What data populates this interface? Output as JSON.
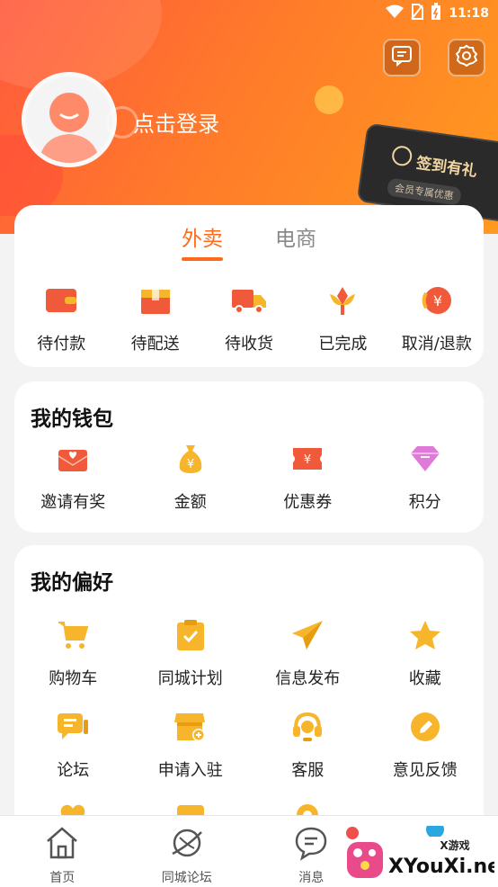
{
  "status_bar": {
    "time": "11:18"
  },
  "profile": {
    "login_label": "点击登录"
  },
  "signin_card": {
    "title": "签到有礼",
    "subtitle": "会员专属优惠"
  },
  "order_tabs": [
    {
      "label": "外卖",
      "active": true
    },
    {
      "label": "电商",
      "active": false
    }
  ],
  "orders": [
    {
      "label": "待付款",
      "icon": "wallet-icon"
    },
    {
      "label": "待配送",
      "icon": "package-icon"
    },
    {
      "label": "待收货",
      "icon": "truck-icon"
    },
    {
      "label": "已完成",
      "icon": "flower-icon"
    },
    {
      "label": "取消/退款",
      "icon": "refund-icon"
    }
  ],
  "wallet": {
    "title": "我的钱包",
    "items": [
      {
        "label": "邀请有奖",
        "icon": "envelope-heart-icon"
      },
      {
        "label": "金额",
        "icon": "money-bag-icon"
      },
      {
        "label": "优惠券",
        "icon": "coupon-icon"
      },
      {
        "label": "积分",
        "icon": "diamond-icon"
      }
    ]
  },
  "preferences": {
    "title": "我的偏好",
    "row1": [
      {
        "label": "购物车",
        "icon": "cart-icon"
      },
      {
        "label": "同城计划",
        "icon": "clipboard-check-icon"
      },
      {
        "label": "信息发布",
        "icon": "paper-plane-icon"
      },
      {
        "label": "收藏",
        "icon": "star-icon"
      }
    ],
    "row2": [
      {
        "label": "论坛",
        "icon": "chat-bubbles-icon"
      },
      {
        "label": "申请入驻",
        "icon": "store-add-icon"
      },
      {
        "label": "客服",
        "icon": "headset-icon"
      },
      {
        "label": "意见反馈",
        "icon": "pencil-circle-icon"
      }
    ]
  },
  "bottom_nav": [
    {
      "label": "首页",
      "icon": "home-icon"
    },
    {
      "label": "同城论坛",
      "icon": "planet-icon"
    },
    {
      "label": "消息",
      "icon": "message-icon"
    }
  ],
  "watermark": {
    "text": "XYouXi.net",
    "badge": "X游戏"
  },
  "colors": {
    "accent": "#ff6a1a",
    "icon_yellow": "#f7b52c",
    "icon_red": "#f0504a",
    "icon_pink": "#e07ad8"
  }
}
